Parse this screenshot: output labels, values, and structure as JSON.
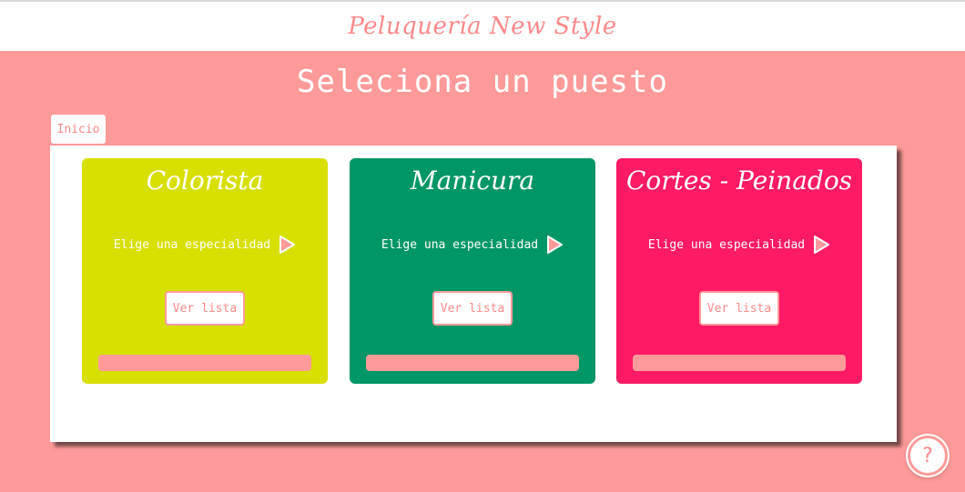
{
  "header": {
    "brand": "Peluquería New Style"
  },
  "page": {
    "title": "Seleciona un puesto"
  },
  "breadcrumb": {
    "home_label": "Inicio"
  },
  "colors": {
    "background": "#ff9a9a",
    "accent": "#ff8a8a",
    "colorista": "#d7e000",
    "manicura": "#009665",
    "cortes": "#ff1a66"
  },
  "cards": [
    {
      "title": "Colorista",
      "specialty_label": "Elige una especialidad",
      "button_label": "Ver lista",
      "icon": "play-icon"
    },
    {
      "title": "Manicura",
      "specialty_label": "Elige una especialidad",
      "button_label": "Ver lista",
      "icon": "play-icon"
    },
    {
      "title": "Cortes - Peinados",
      "specialty_label": "Elige una especialidad",
      "button_label": "Ver lista",
      "icon": "play-icon"
    }
  ],
  "help": {
    "label": "?"
  }
}
